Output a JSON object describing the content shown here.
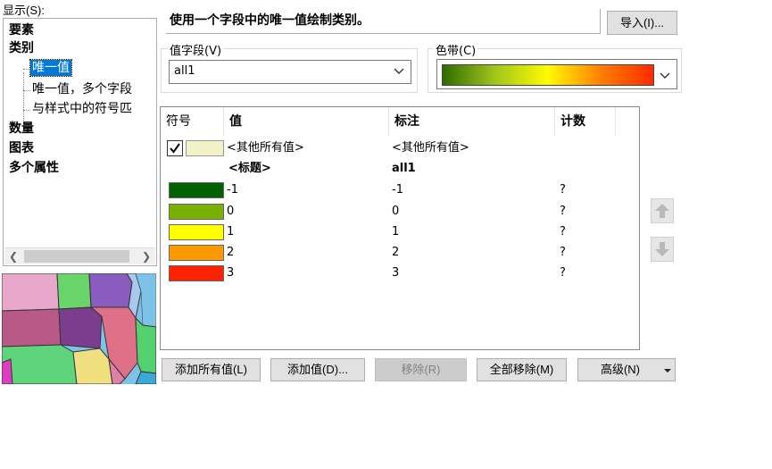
{
  "display_label": "显示(S):",
  "tree": {
    "categories": [
      "要素",
      "类别",
      "数量",
      "图表",
      "多个属性"
    ],
    "subitems": [
      "唯一值",
      "唯一值，多个字段",
      "与样式中的符号匹"
    ]
  },
  "description": "使用一个字段中的唯一值绘制类别。",
  "import_button": "导入(I)...",
  "value_field": {
    "label": "值字段(V)",
    "value": "all1"
  },
  "color_ramp": {
    "label": "色带(C)",
    "colors": [
      "#2f6b00",
      "#a2c61b",
      "#fffb00",
      "#ff7f00",
      "#ff2a00"
    ]
  },
  "table": {
    "headers": [
      "符号",
      "值",
      "标注",
      "计数"
    ],
    "other_values": {
      "value": "<其他所有值>",
      "label": "<其他所有值>",
      "swatch_color": "#f2f2c8"
    },
    "heading": {
      "value": "<标题>",
      "label": "all1"
    },
    "rows": [
      {
        "value": "-1",
        "label": "-1",
        "count": "?",
        "color": "#006100"
      },
      {
        "value": "0",
        "label": "0",
        "count": "?",
        "color": "#7ab000"
      },
      {
        "value": "1",
        "label": "1",
        "count": "?",
        "color": "#ffff00"
      },
      {
        "value": "2",
        "label": "2",
        "count": "?",
        "color": "#ff9900"
      },
      {
        "value": "3",
        "label": "3",
        "count": "?",
        "color": "#ff2200"
      }
    ]
  },
  "buttons": {
    "add_all": "添加所有值(L)",
    "add_values": "添加值(D)...",
    "remove": "移除(R)",
    "remove_all": "全部移除(M)",
    "advanced": "高级(N)"
  }
}
